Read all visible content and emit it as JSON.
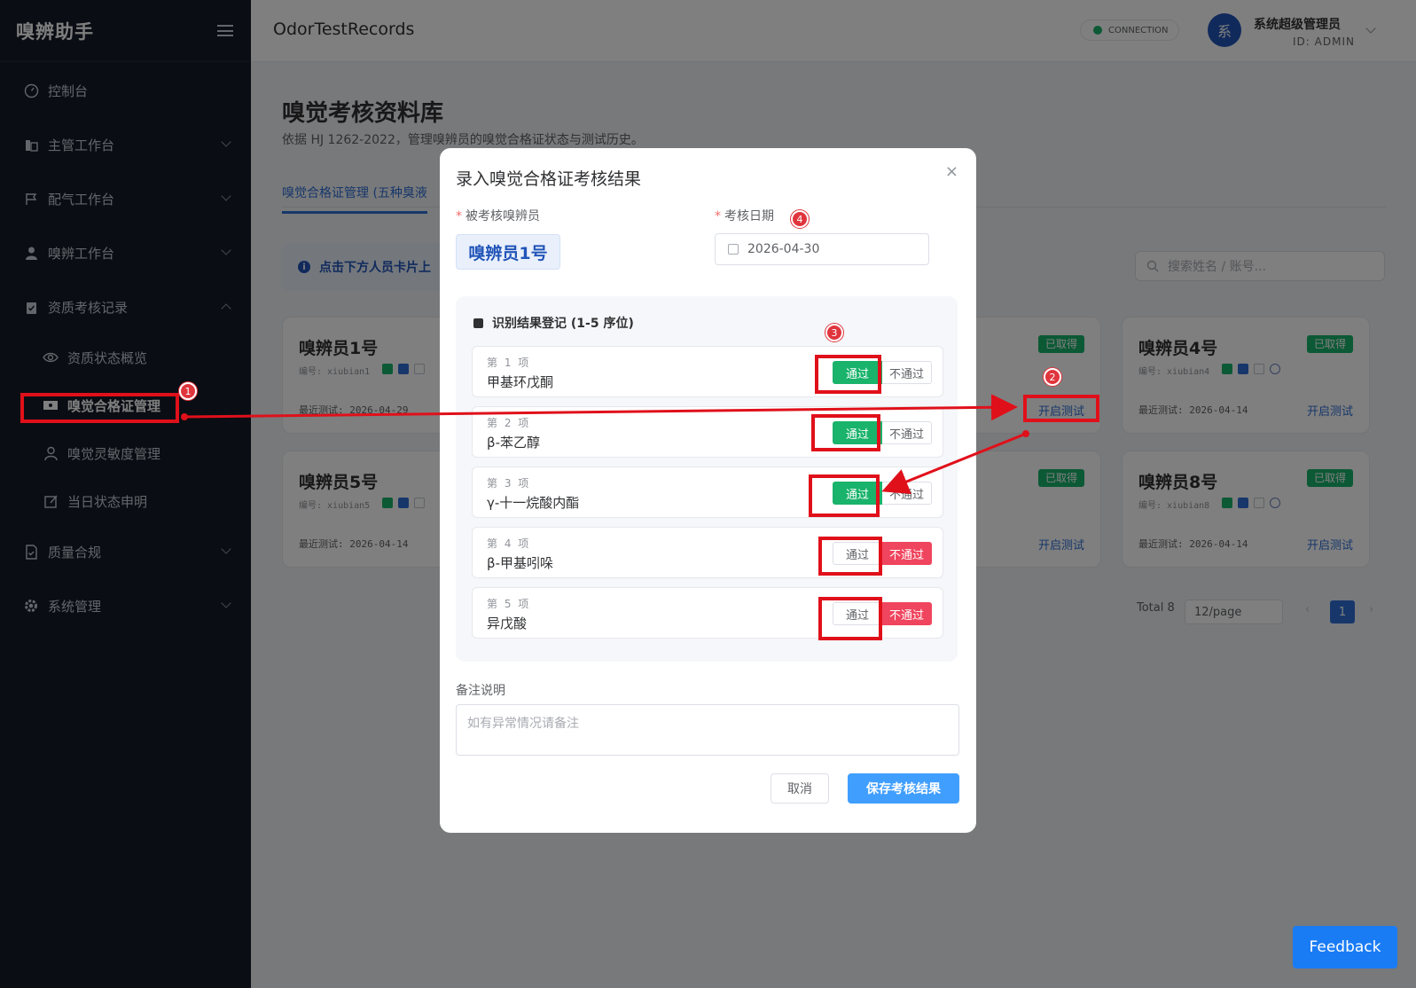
{
  "sidebar": {
    "logo": "嗅辨助手",
    "items": [
      {
        "label": "控制台",
        "icon": "dashboard-icon"
      },
      {
        "label": "主管工作台",
        "icon": "building-icon"
      },
      {
        "label": "配气工作台",
        "icon": "flag-icon"
      },
      {
        "label": "嗅辨工作台",
        "icon": "user-icon"
      },
      {
        "label": "资质考核记录",
        "icon": "clipboard-icon"
      },
      {
        "label": "资质状态概览",
        "icon": "eye-icon"
      },
      {
        "label": "嗅觉合格证管理",
        "icon": "ticket-icon"
      },
      {
        "label": "嗅觉灵敏度管理",
        "icon": "person-icon"
      },
      {
        "label": "当日状态申明",
        "icon": "edit-icon"
      },
      {
        "label": "质量合规",
        "icon": "document-check-icon"
      },
      {
        "label": "系统管理",
        "icon": "gear-icon"
      }
    ]
  },
  "header": {
    "project": "OdorTestRecords",
    "connection": "CONNECTION",
    "avatar_char": "系",
    "user_name": "系统超级管理员",
    "user_id": "ID: ADMIN"
  },
  "page": {
    "title": "嗅觉考核资料库",
    "subtitle": "依据 HJ 1262-2022，管理嗅辨员的嗅觉合格证状态与测试历史。",
    "tab": "嗅觉合格证管理 (五种臭液",
    "hint": "点击下方人员卡片上",
    "search_placeholder": "搜索姓名 / 账号..."
  },
  "cards": [
    {
      "name": "嗅辨员1号",
      "no": "编号: xiubian1",
      "last": "最近测试: 2026-04-29",
      "badge": "",
      "open": ""
    },
    {
      "name": "",
      "no": "",
      "last": "",
      "badge": "已取得",
      "open": "开启测试"
    },
    {
      "name": "嗅辨员4号",
      "no": "编号: xiubian4",
      "last": "最近测试: 2026-04-14",
      "badge": "已取得",
      "open": "开启测试"
    },
    {
      "name": "嗅辨员5号",
      "no": "编号: xiubian5",
      "last": "最近测试: 2026-04-14",
      "badge": "",
      "open": ""
    },
    {
      "name": "",
      "no": "",
      "last": "",
      "badge": "已取得",
      "open": "开启测试"
    },
    {
      "name": "嗅辨员8号",
      "no": "编号: xiubian8",
      "last": "最近测试: 2026-04-14",
      "badge": "已取得",
      "open": "开启测试"
    }
  ],
  "pagination": {
    "total": "Total 8",
    "size": "12/page",
    "current": "1"
  },
  "modal": {
    "title": "录入嗅觉合格证考核结果",
    "close": "×",
    "examinee_label": "被考核嗅辨员",
    "examinee": "嗅辨员1号",
    "date_label": "考核日期",
    "date": "2026-04-30",
    "section_title": "识别结果登记 (1-5 序位)",
    "items": [
      {
        "no": "第 1 项",
        "name": "甲基环戊酮",
        "result": "pass"
      },
      {
        "no": "第 2 项",
        "name": "β-苯乙醇",
        "result": "pass"
      },
      {
        "no": "第 3 项",
        "name": "γ-十一烷酸内酯",
        "result": "pass"
      },
      {
        "no": "第 4 项",
        "name": "β-甲基吲哚",
        "result": "fail"
      },
      {
        "no": "第 5 项",
        "name": "异戊酸",
        "result": "fail"
      }
    ],
    "pass_label": "通过",
    "fail_label": "不通过",
    "remark_label": "备注说明",
    "remark_placeholder": "如有异常情况请备注",
    "cancel": "取消",
    "save": "保存考核结果"
  },
  "feedback": "Feedback",
  "annotations": [
    "1",
    "2",
    "3",
    "4"
  ],
  "colors": {
    "sidebar": "#141a26",
    "accent": "#2f6fd6",
    "pass": "#19b36b",
    "fail": "#f0455e",
    "annotation": "#e0101a"
  }
}
